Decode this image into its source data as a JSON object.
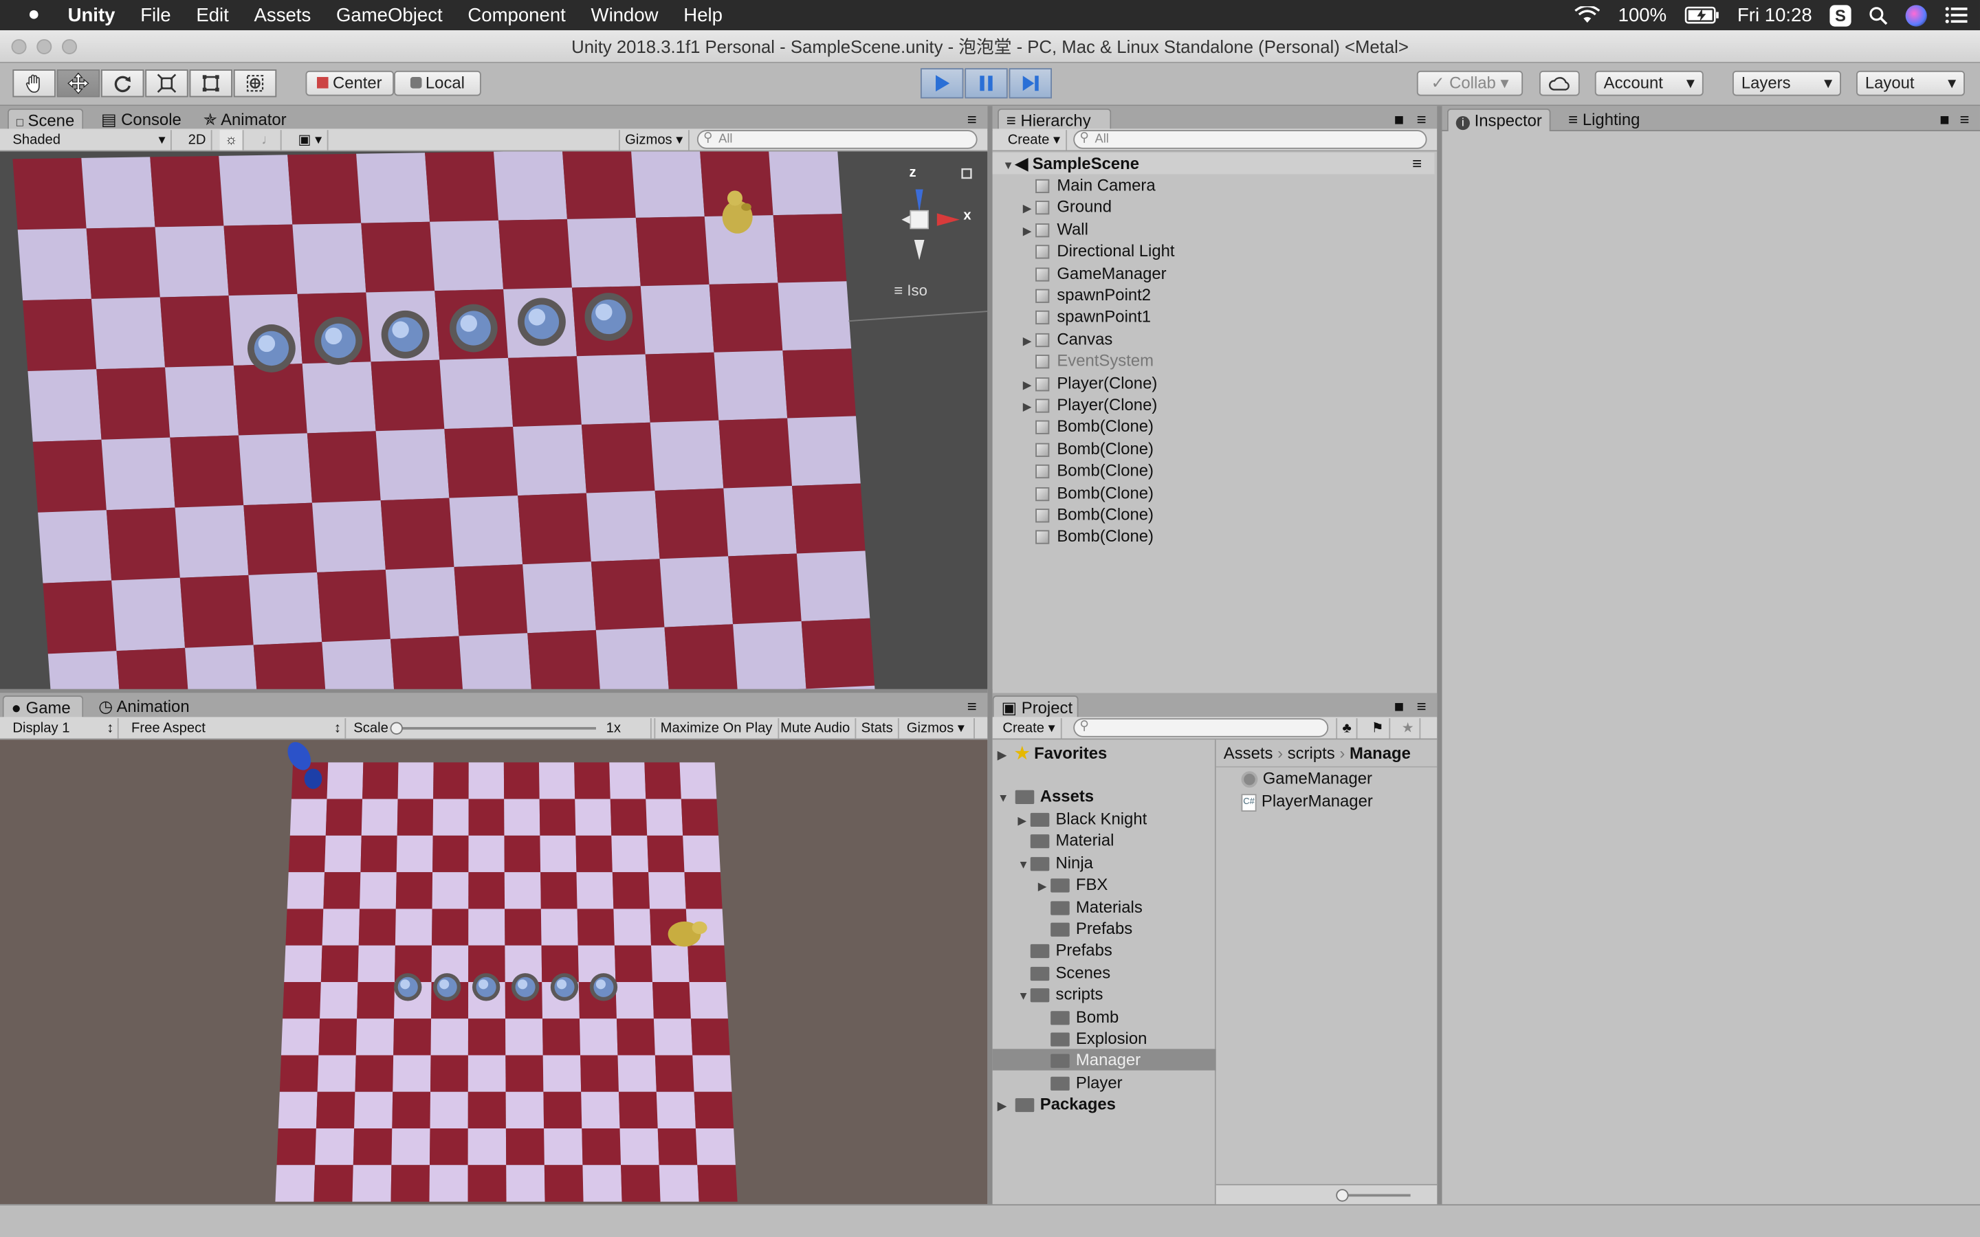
{
  "menubar": {
    "apple_icon": "apple-icon",
    "items": [
      "Unity",
      "File",
      "Edit",
      "Assets",
      "GameObject",
      "Component",
      "Window",
      "Help"
    ],
    "battery": "100%",
    "clock": "Fri 10:28"
  },
  "window": {
    "title": "Unity 2018.3.1f1 Personal - SampleScene.unity - 泡泡堂 - PC, Mac & Linux Standalone (Personal) <Metal>"
  },
  "toolbar": {
    "pivot_label": "Center",
    "space_label": "Local",
    "collab_label": "Collab",
    "account_label": "Account",
    "layers_label": "Layers",
    "layout_label": "Layout"
  },
  "scene_panel": {
    "tabs": [
      "Scene",
      "Console",
      "Animator"
    ],
    "shading": "Shaded",
    "mode_2d": "2D",
    "gizmos": "Gizmos",
    "search_placeholder": "All",
    "gizmo_axes": {
      "z": "z",
      "x": "x"
    },
    "projection": "Iso"
  },
  "game_panel": {
    "tabs": [
      "Game",
      "Animation"
    ],
    "display": "Display 1",
    "aspect": "Free Aspect",
    "scale_label": "Scale",
    "scale_value": "1x",
    "buttons": [
      "Maximize On Play",
      "Mute Audio",
      "Stats",
      "Gizmos"
    ]
  },
  "hierarchy": {
    "tab": "Hierarchy",
    "create": "Create",
    "search_placeholder": "All",
    "scene": "SampleScene",
    "items": [
      {
        "label": "Main Camera",
        "expandable": false,
        "dim": false
      },
      {
        "label": "Ground",
        "expandable": true,
        "dim": false
      },
      {
        "label": "Wall",
        "expandable": true,
        "dim": false
      },
      {
        "label": "Directional Light",
        "expandable": false,
        "dim": false
      },
      {
        "label": "GameManager",
        "expandable": false,
        "dim": false
      },
      {
        "label": "spawnPoint2",
        "expandable": false,
        "dim": false
      },
      {
        "label": "spawnPoint1",
        "expandable": false,
        "dim": false
      },
      {
        "label": "Canvas",
        "expandable": true,
        "dim": false
      },
      {
        "label": "EventSystem",
        "expandable": false,
        "dim": true
      },
      {
        "label": "Player(Clone)",
        "expandable": true,
        "dim": false
      },
      {
        "label": "Player(Clone)",
        "expandable": true,
        "dim": false
      },
      {
        "label": "Bomb(Clone)",
        "expandable": false,
        "dim": false
      },
      {
        "label": "Bomb(Clone)",
        "expandable": false,
        "dim": false
      },
      {
        "label": "Bomb(Clone)",
        "expandable": false,
        "dim": false
      },
      {
        "label": "Bomb(Clone)",
        "expandable": false,
        "dim": false
      },
      {
        "label": "Bomb(Clone)",
        "expandable": false,
        "dim": false
      },
      {
        "label": "Bomb(Clone)",
        "expandable": false,
        "dim": false
      }
    ]
  },
  "inspector": {
    "tabs": [
      "Inspector",
      "Lighting"
    ]
  },
  "project": {
    "tab": "Project",
    "create": "Create",
    "favorites": "Favorites",
    "assets": "Assets",
    "tree": [
      {
        "label": "Black Knight",
        "depth": 1,
        "arrow": "right"
      },
      {
        "label": "Material",
        "depth": 1,
        "arrow": ""
      },
      {
        "label": "Ninja",
        "depth": 1,
        "arrow": "down"
      },
      {
        "label": "FBX",
        "depth": 2,
        "arrow": "right"
      },
      {
        "label": "Materials",
        "depth": 2,
        "arrow": ""
      },
      {
        "label": "Prefabs",
        "depth": 2,
        "arrow": ""
      },
      {
        "label": "Prefabs",
        "depth": 1,
        "arrow": ""
      },
      {
        "label": "Scenes",
        "depth": 1,
        "arrow": ""
      },
      {
        "label": "scripts",
        "depth": 1,
        "arrow": "down"
      },
      {
        "label": "Bomb",
        "depth": 2,
        "arrow": ""
      },
      {
        "label": "Explosion",
        "depth": 2,
        "arrow": ""
      },
      {
        "label": "Manager",
        "depth": 2,
        "arrow": "",
        "selected": true
      },
      {
        "label": "Player",
        "depth": 2,
        "arrow": ""
      }
    ],
    "packages": "Packages",
    "breadcrumb": [
      "Assets",
      "scripts",
      "Manage"
    ],
    "files": [
      "GameManager",
      "PlayerManager"
    ]
  }
}
